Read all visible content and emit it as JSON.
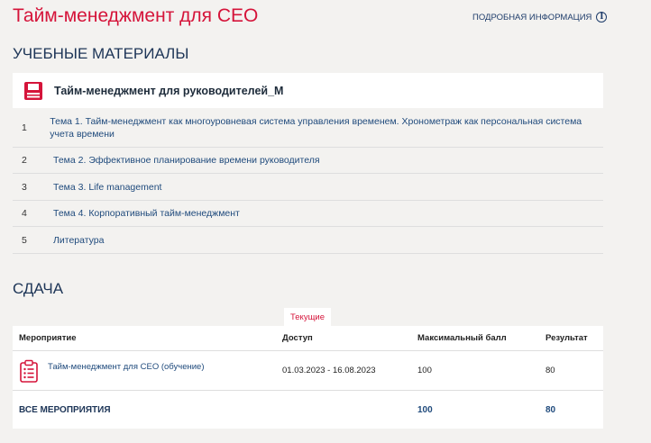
{
  "header": {
    "title": "Тайм-менеджмент для CEO",
    "info_link": "ПОДРОБНАЯ ИНФОРМАЦИЯ",
    "info_icon": "info-icon"
  },
  "materials": {
    "section_title": "УЧЕБНЫЕ МАТЕРИАЛЫ",
    "course_icon": "floppy-disk-icon",
    "course_title": "Тайм-менеджмент для руководителей_М",
    "topics": [
      {
        "num": "1",
        "label": "Тема 1. Тайм-менеджмент как многоуровневая система управления временем. Хронометраж как персональная система учета времени"
      },
      {
        "num": "2",
        "label": "Тема 2. Эффективное планирование времени руководителя"
      },
      {
        "num": "3",
        "label": "Тема 3. Life management"
      },
      {
        "num": "4",
        "label": "Тема 4. Корпоративный тайм-менеджмент"
      },
      {
        "num": "5",
        "label": "Литература"
      }
    ]
  },
  "submission": {
    "section_title": "СДАЧА",
    "tab_current": "Текущие",
    "columns": {
      "event": "Мероприятие",
      "access": "Доступ",
      "max_score": "Максимальный балл",
      "result": "Результат"
    },
    "rows": [
      {
        "icon": "clipboard-icon",
        "event": "Тайм-менеджмент для CEO (обучение)",
        "access": "01.03.2023 - 16.08.2023",
        "max_score": "100",
        "result": "80"
      }
    ],
    "total": {
      "label": "ВСЕ МЕРОПРИЯТИЯ",
      "max_score": "100",
      "result": "80"
    }
  },
  "colors": {
    "accent": "#d5143a",
    "link": "#1f4a7c",
    "heading": "#1d3557",
    "background": "#f3f2f0"
  }
}
